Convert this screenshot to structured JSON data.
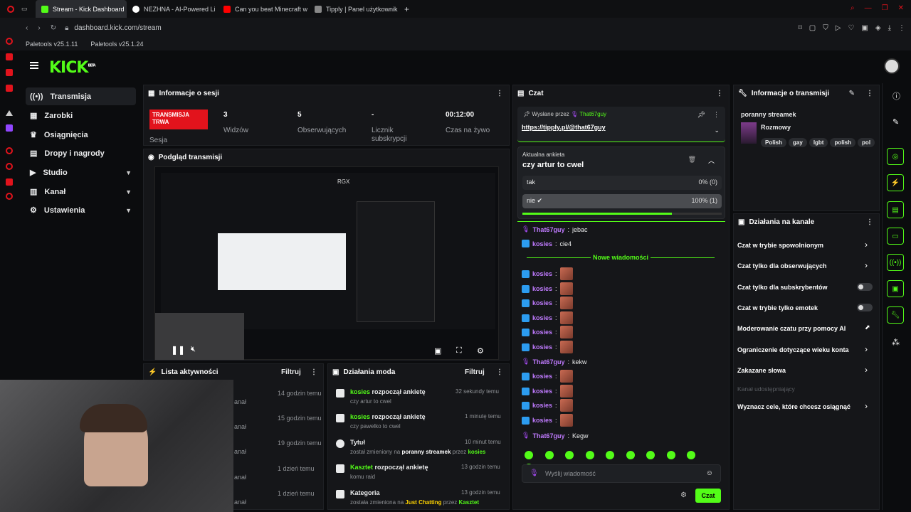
{
  "browser": {
    "tabs": [
      {
        "label": "Stream - Kick Dashboard",
        "color": "#53fc18",
        "active": true
      },
      {
        "label": "NEZHNA - AI-Powered Li",
        "color": "#ffffff"
      },
      {
        "label": "Can you beat Minecraft w",
        "color": "#ff0000"
      },
      {
        "label": "Tipply | Panel użytkownik",
        "color": "#cccccc"
      }
    ],
    "new_tab": "+",
    "url": "dashboard.kick.com/stream",
    "bookmarks": [
      "Paletools v25.1.11",
      "Paletools v25.1.24"
    ]
  },
  "header": {
    "logo": "KICK",
    "logo_sup": "BETA"
  },
  "sidebar": {
    "items": [
      {
        "label": "Transmisja",
        "icon": "broadcast-icon",
        "active": true
      },
      {
        "label": "Zarobki",
        "icon": "wallet-icon"
      },
      {
        "label": "Osiągnięcia",
        "icon": "trophy-icon"
      },
      {
        "label": "Dropy i nagrody",
        "icon": "gift-icon"
      },
      {
        "label": "Studio",
        "icon": "video-icon",
        "chevron": true
      },
      {
        "label": "Kanał",
        "icon": "channel-icon",
        "chevron": true
      },
      {
        "label": "Ustawienia",
        "icon": "gear-icon",
        "chevron": true
      }
    ]
  },
  "session": {
    "title": "Informacje o sesji",
    "live_badge": "TRANSMISJA TRWA",
    "live_label": "Sesja",
    "stats": [
      {
        "value": "3",
        "label": "Widzów"
      },
      {
        "value": "5",
        "label": "Obserwujących"
      },
      {
        "value": "-",
        "label": "Licznik subskrypcji"
      },
      {
        "value": "00:12:00",
        "label": "Czas na żywo"
      }
    ]
  },
  "preview": {
    "title": "Podgląd transmisji",
    "overlay_label": "RGX"
  },
  "activity": {
    "title": "Lista aktywności",
    "filter": "Filtruj",
    "times": [
      "14 godzin temu",
      "15 godzin temu",
      "19 godzin temu",
      "1 dzień temu",
      "1 dzień temu"
    ],
    "partials": [
      "anał",
      "anał",
      "anał",
      "anał",
      "anał"
    ]
  },
  "mod": {
    "title": "Działania moda",
    "filter": "Filtruj",
    "items": [
      {
        "user": "kosies",
        "action": "rozpoczął ankietę",
        "sub": "czy artur to cwel",
        "time": "32 sekundy temu"
      },
      {
        "user": "kosies",
        "action": "rozpoczął ankietę",
        "sub": "czy pawelko to cwel",
        "time": "1 minutę temu"
      },
      {
        "user": "Tytuł",
        "action": "",
        "sub_pre": "został zmieniony na",
        "sub_hl": "poranny streamek",
        "sub_mid": "przez",
        "sub_user": "kosies",
        "time": "10 minut temu"
      },
      {
        "user": "Kasztet",
        "action": "rozpoczął ankietę",
        "sub": "komu raid",
        "time": "13 godzin temu"
      },
      {
        "user": "Kategoria",
        "action": "",
        "sub_pre": "została zmieniona na",
        "sub_hl": "Just Chatting",
        "sub_mid": "przez",
        "sub_user": "Kasztet",
        "time": "13 godzin temu"
      }
    ]
  },
  "chat": {
    "title": "Czat",
    "pinned_by": "Wysłane przez",
    "pinned_user": "That67guy",
    "pinned_link": "https://tipply.pl/@that67guy",
    "poll_label": "Aktualna ankieta",
    "poll_question": "czy artur to cwel",
    "poll_options": [
      {
        "label": "tak",
        "result": "0% (0)"
      },
      {
        "label": "nie",
        "result": "100% (1)"
      }
    ],
    "poll_progress": 0.75,
    "new_messages": "Nowe wiadomości",
    "messages": [
      {
        "user": "That67guy",
        "text": "jebac",
        "badge": "mic"
      },
      {
        "user": "kosies",
        "text": "cie4",
        "badge": "kick"
      },
      {
        "user": "kosies",
        "text": "",
        "emote": true
      },
      {
        "user": "kosies",
        "text": "",
        "emote": true
      },
      {
        "user": "kosies",
        "text": "",
        "emote": true
      },
      {
        "user": "kosies",
        "text": "",
        "emote": true
      },
      {
        "user": "kosies",
        "text": "",
        "emote": true
      },
      {
        "user": "kosies",
        "text": "",
        "emote": true
      },
      {
        "user": "That67guy",
        "text": "kekw",
        "badge": "mic"
      },
      {
        "user": "kosies",
        "text": "",
        "emote": true
      },
      {
        "user": "kosies",
        "text": "",
        "emote": true
      },
      {
        "user": "kosies",
        "text": "",
        "emote": true
      },
      {
        "user": "kosies",
        "text": "",
        "emote": true
      },
      {
        "user": "That67guy",
        "text": "Kegw",
        "badge": "mic"
      }
    ],
    "input_placeholder": "Wyślij wiadomość",
    "send": "Czat"
  },
  "stream_info": {
    "title": "Informacje o transmisji",
    "stream_title": "poranny streamek",
    "category": "Rozmowy",
    "tags": [
      "Polish",
      "gay",
      "lgbt",
      "polish",
      "pol"
    ]
  },
  "channel_actions": {
    "title": "Działania na kanale",
    "items": [
      {
        "label": "Czat w trybie spowolnionym",
        "control": "arrow"
      },
      {
        "label": "Czat tylko dla obserwujących",
        "control": "arrow"
      },
      {
        "label": "Czat tylko dla subskrybentów",
        "control": "toggle"
      },
      {
        "label": "Czat w trybie tylko emotek",
        "control": "toggle"
      },
      {
        "label": "Moderowanie czatu przy pomocy AI",
        "control": "chart"
      },
      {
        "label": "Ograniczenie dotyczące wieku konta",
        "control": "arrow"
      },
      {
        "label": "Zakazane słowa",
        "control": "arrow"
      },
      {
        "label": "Kanał udostępniający",
        "control": "none",
        "disabled": true
      },
      {
        "label": "Wyznacz cele, które chcesz osiągnąć",
        "control": "arrow"
      }
    ]
  },
  "colors": {
    "accent": "#53fc18",
    "live": "#e2131c",
    "kick_badge": "#2c9cf0",
    "mic_badge": "#a64bf4"
  }
}
